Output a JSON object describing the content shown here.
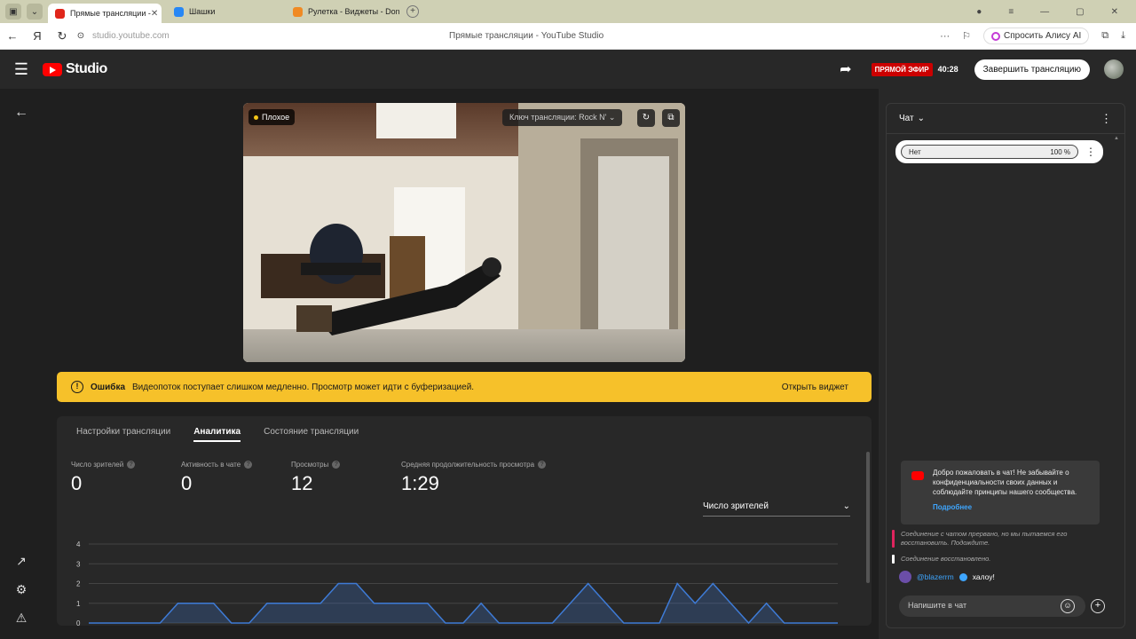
{
  "browser": {
    "tabs": [
      {
        "label": "Прямые трансляции -",
        "active": true,
        "color": "#e0261b"
      },
      {
        "label": "Шашки",
        "active": false,
        "color": "#2787f5"
      },
      {
        "label": "Рулетка - Виджеты - Dona",
        "active": false,
        "color": "#f08a24"
      }
    ],
    "url": "studio.youtube.com",
    "page_title": "Прямые трансляции - YouTube Studio",
    "alice_label": "Спросить Алису AI"
  },
  "header": {
    "logo_text": "Studio",
    "live_badge": "ПРЯМОЙ ЭФИР",
    "live_time": "40:28",
    "end_button": "Завершить трансляцию"
  },
  "preview": {
    "quality": "Плохое",
    "stream_key": "Ключ трансляции: Rock N'"
  },
  "error": {
    "title": "Ошибка",
    "message": "Видеопоток поступает слишком медленно. Просмотр может идти с буферизацией.",
    "link": "Открыть виджет"
  },
  "panel": {
    "tabs": [
      "Настройки трансляции",
      "Аналитика",
      "Состояние трансляции"
    ],
    "active_tab": 1,
    "metrics": [
      {
        "label": "Число зрителей",
        "value": "0"
      },
      {
        "label": "Активность в чате",
        "value": "0"
      },
      {
        "label": "Просмотры",
        "value": "12"
      },
      {
        "label": "Средняя продолжительность просмотра",
        "value": "1:29"
      }
    ],
    "dropdown": "Число зрителей"
  },
  "chart_data": {
    "type": "area",
    "y_ticks": [
      "4",
      "3",
      "2",
      "1",
      "0"
    ],
    "ylim": [
      0,
      4
    ],
    "values": [
      0,
      0,
      0,
      0,
      0,
      1,
      1,
      1,
      0,
      0,
      1,
      1,
      1,
      1,
      2,
      2,
      1,
      1,
      1,
      1,
      0,
      0,
      1,
      0,
      0,
      0,
      0,
      1,
      2,
      1,
      0,
      0,
      0,
      2,
      1,
      2,
      1,
      0,
      1,
      0,
      0,
      0,
      0
    ],
    "color": "#3e7bd6"
  },
  "chat": {
    "title": "Чат",
    "poll_option": "Нет",
    "poll_percent": "100 %",
    "welcome": "Добро пожаловать в чат! Не забывайте о конфиденциальности своих данных и соблюдайте принципы нашего сообщества.",
    "welcome_link": "Подробнее",
    "sys_messages": [
      {
        "text": "Соединение с чатом прервано, но мы пытаемся его восстановить. Подождите.",
        "color": "#e0245e"
      },
      {
        "text": "Соединение восстановлено.",
        "color": "#ffffff"
      }
    ],
    "message": {
      "author": "@blazerrm",
      "text": "халоу!"
    },
    "input_placeholder": "Напишите в чат"
  }
}
